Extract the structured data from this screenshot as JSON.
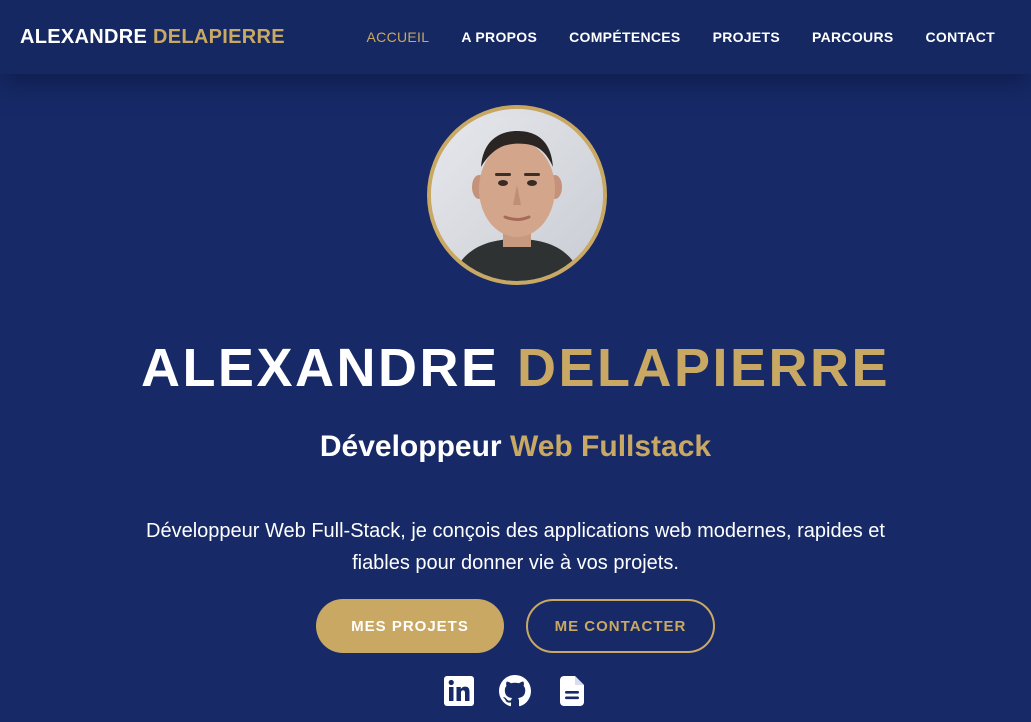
{
  "navbar": {
    "brand_first": "ALEXANDRE",
    "brand_last": "DELAPIERRE",
    "links": [
      {
        "label": "ACCUEIL",
        "active": true
      },
      {
        "label": "A PROPOS",
        "active": false
      },
      {
        "label": "COMPÉTENCES",
        "active": false
      },
      {
        "label": "PROJETS",
        "active": false
      },
      {
        "label": "PARCOURS",
        "active": false
      },
      {
        "label": "CONTACT",
        "active": false
      }
    ]
  },
  "hero": {
    "name_first": "ALEXANDRE",
    "name_last": "DELAPIERRE",
    "subtitle_first": "Développeur",
    "subtitle_accent": "Web Fullstack",
    "description": "Développeur Web Full-Stack, je conçois des applications web modernes, rapides et fiables pour donner vie à vos projets.",
    "primary_button": "MES PROJETS",
    "secondary_button": "ME CONTACTER"
  },
  "socials": [
    {
      "icon": "linkedin-icon"
    },
    {
      "icon": "github-icon"
    },
    {
      "icon": "document-icon"
    }
  ],
  "colors": {
    "background": "#172a67",
    "accent": "#c9a863",
    "text": "#ffffff"
  }
}
